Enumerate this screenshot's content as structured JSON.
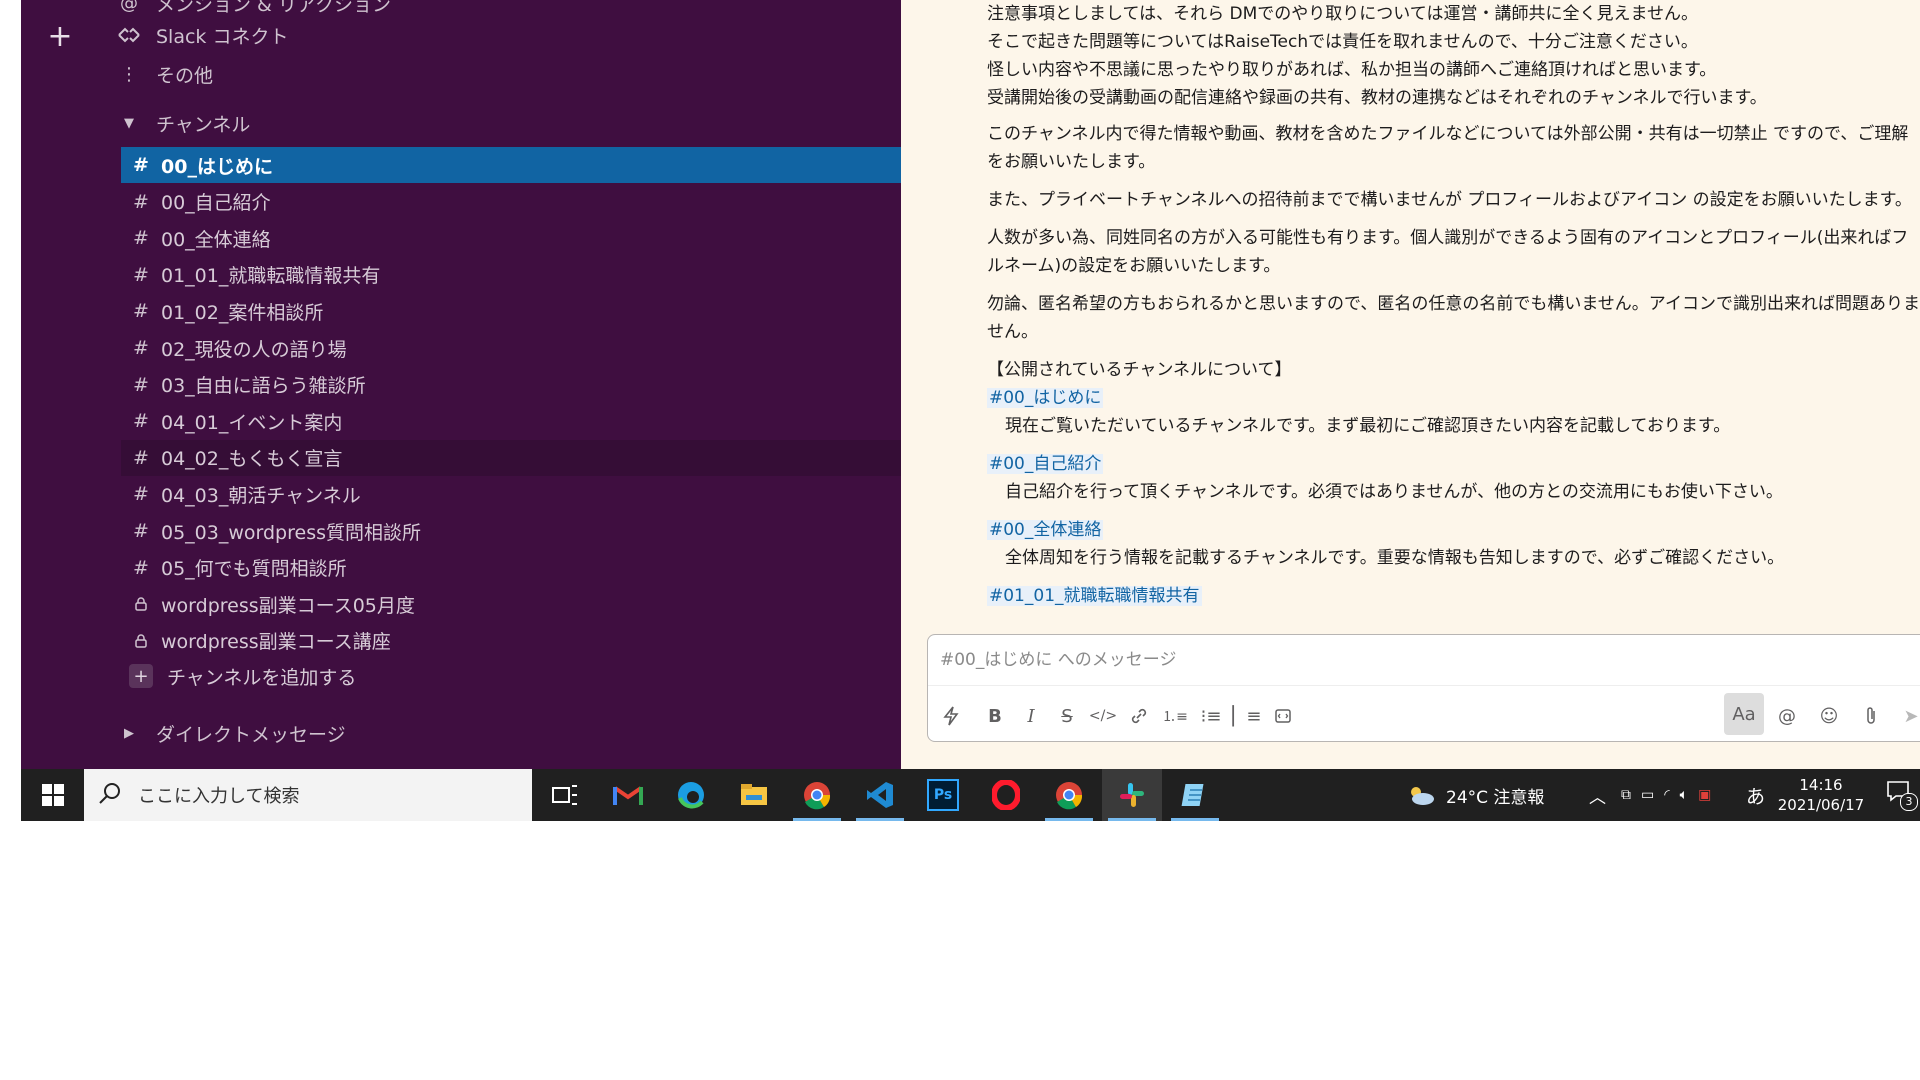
{
  "sidebar": {
    "top_items": [
      {
        "icon": "at-icon",
        "label": "メンション & リアクション"
      },
      {
        "icon": "connect-icon",
        "label": "Slack コネクト"
      },
      {
        "icon": "more-vertical-icon",
        "label": "その他"
      }
    ],
    "channels_section": "チャンネル",
    "channels": [
      {
        "name": "00_はじめに",
        "type": "public",
        "active": true
      },
      {
        "name": "00_自己紹介",
        "type": "public"
      },
      {
        "name": "00_全体連絡",
        "type": "public"
      },
      {
        "name": "01_01_就職転職情報共有",
        "type": "public"
      },
      {
        "name": "01_02_案件相談所",
        "type": "public"
      },
      {
        "name": "02_現役の人の語り場",
        "type": "public"
      },
      {
        "name": "03_自由に語らう雑談所",
        "type": "public"
      },
      {
        "name": "04_01_イベント案内",
        "type": "public"
      },
      {
        "name": "04_02_もくもく宣言",
        "type": "public",
        "hover": true
      },
      {
        "name": "04_03_朝活チャンネル",
        "type": "public"
      },
      {
        "name": "05_03_wordpress質問相談所",
        "type": "public"
      },
      {
        "name": "05_何でも質問相談所",
        "type": "public"
      },
      {
        "name": "wordpress副業コース05月度",
        "type": "private"
      },
      {
        "name": "wordpress副業コース講座",
        "type": "private"
      }
    ],
    "add_channel": "チャンネルを追加する",
    "dm_section": "ダイレクトメッセージ"
  },
  "message": {
    "p1": [
      "注意事項としましては、それら DMでのやり取りについては運営・講師共に全く見えません。",
      "そこで起きた問題等についてはRaiseTechでは責任を取れませんので、十分ご注意ください。",
      "怪しい内容や不思議に思ったやり取りがあれば、私か担当の講師へご連絡頂ければと思います。",
      "受講開始後の受講動画の配信連絡や録画の共有、教材の連携などはそれぞれのチャンネルで行います。"
    ],
    "p2": "このチャンネル内で得た情報や動画、教材を含めたファイルなどについては外部公開・共有は一切禁止 ですので、ご理解をお願いいたします。",
    "p3": "また、プライベートチャンネルへの招待前までで構いませんが プロフィールおよびアイコン の設定をお願いいたします。",
    "p4": "人数が多い為、同姓同名の方が入る可能性も有ります。個人識別ができるよう固有のアイコンとプロフィール(出来ればフルネーム)の設定をお願いいたします。",
    "p5": "勿論、匿名希望の方もおられるかと思いますので、匿名の任意の名前でも構いません。アイコンで識別出来れば問題ありません。",
    "list_heading": "【公開されているチャンネルについて】",
    "channel_list": [
      {
        "link": "#00_はじめに",
        "desc": "現在ご覧いただいているチャンネルです。まず最初にご確認頂きたい内容を記載しております。"
      },
      {
        "link": "#00_自己紹介",
        "desc": "自己紹介を行って頂くチャンネルです。必須ではありませんが、他の方との交流用にもお使い下さい。"
      },
      {
        "link": "#00_全体連絡",
        "desc": "全体周知を行う情報を記載するチャンネルです。重要な情報も告知しますので、必ずご確認ください。"
      },
      {
        "link": "#01_01_就職転職情報共有",
        "desc": ""
      }
    ]
  },
  "composer": {
    "placeholder": "#00_はじめに へのメッセージ",
    "format_label": "Aa"
  },
  "taskbar": {
    "search_placeholder": "ここに入力して検索",
    "weather": "24°C 注意報",
    "ime": "あ",
    "time": "14:16",
    "date": "2021/06/17",
    "notifications": "3",
    "apps": [
      "task-view-icon",
      "gmail-icon",
      "edge-icon",
      "file-explorer-icon",
      "chrome-icon",
      "vscode-icon",
      "photoshop-icon",
      "opera-icon",
      "chrome-icon",
      "slack-icon",
      "notepad-icon"
    ],
    "ps_label": "Ps"
  },
  "colors": {
    "sidebar_bg": "#3f0e40",
    "active_channel": "#1164a3",
    "main_bg": "#fdf6ea",
    "link": "#1264a3",
    "taskbar": "#202020"
  }
}
